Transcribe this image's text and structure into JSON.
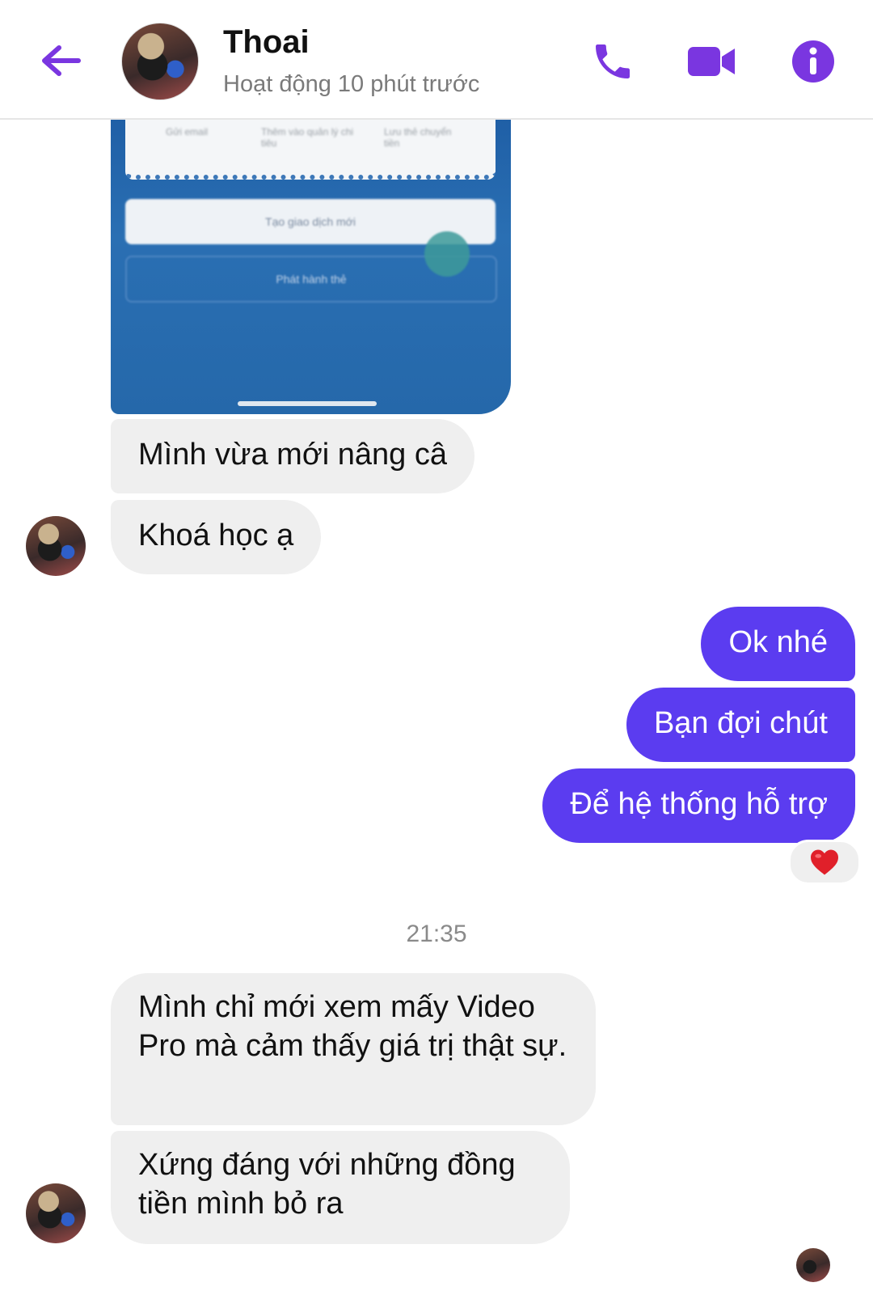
{
  "header": {
    "contact_name": "Thoai",
    "status": "Hoạt động 10 phút trước",
    "icons": [
      "back-arrow-icon",
      "phone-icon",
      "video-camera-icon",
      "info-icon"
    ]
  },
  "attachment": {
    "card_cells": [
      "Gửi email",
      "Thêm vào quản lý chi tiêu",
      "Lưu thẻ chuyển tiền"
    ],
    "button_primary": "Tạo giao dịch mới",
    "button_secondary": "Phát hành thẻ"
  },
  "messages": [
    {
      "side": "in",
      "text": "Mình vừa mới nâng câ"
    },
    {
      "side": "in",
      "text": "Khoá học ạ"
    },
    {
      "side": "out",
      "text": "Ok nhé"
    },
    {
      "side": "out",
      "text": "Bạn đợi chút"
    },
    {
      "side": "out",
      "text": "Để hệ thống hỗ trợ",
      "reaction": "❤️"
    },
    {
      "side": "in",
      "text": "Mình chỉ mới xem mấy Video Pro mà cảm thấy giá trị thật sự."
    },
    {
      "side": "in",
      "text": "Xứng đáng với những đồng tiền mình bỏ ra"
    }
  ],
  "timestamp": "21:35",
  "colors": {
    "accent": "#7a36e0",
    "outgoing_bubble": "#5b3cf0",
    "incoming_bubble": "#efefef",
    "reaction_heart": "#e0202a"
  }
}
